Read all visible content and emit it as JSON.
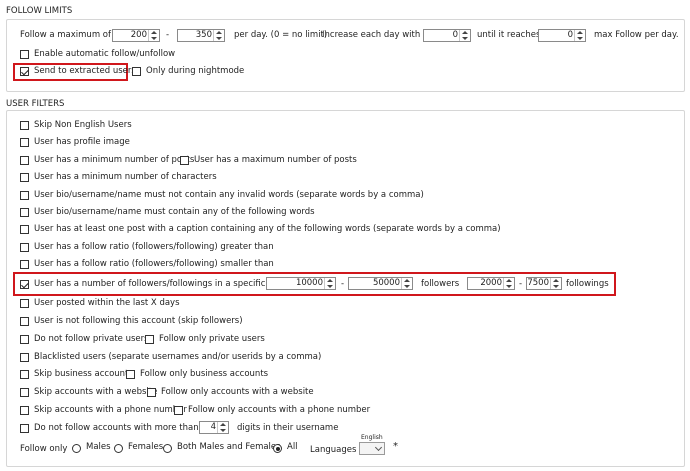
{
  "follow_limits": {
    "section_title": "FOLLOW LIMITS",
    "prefix": "Follow a maximum of",
    "min_value": "200",
    "dash": "-",
    "max_value": "350",
    "per_day": "per day. (0 = no limit)",
    "increase_label": "Increase each day with",
    "increase_value": "0",
    "until_label": "until it reaches",
    "until_value": "0",
    "max_follow_label": "max Follow per day.",
    "auto_follow_label": "Enable automatic follow/unfollow",
    "send_extracted_label": "Send to extracted users",
    "nightmode_label": "Only during nightmode"
  },
  "user_filters": {
    "section_title": "USER FILTERS",
    "skip_non_english": "Skip Non English Users",
    "has_profile_image": "User has profile image",
    "min_posts": "User has a minimum number of posts",
    "max_posts": "User has a maximum number of posts",
    "bio_min_chars": "User has a minimum number of characters",
    "bio_invalid_words": "User bio/username/name must not contain any invalid words (separate words by a comma)",
    "bio_contain_words": "User bio/username/name must contain any of the following words",
    "post_caption_words": "User has at least one post with a caption containing any of the following words (separate words by a comma)",
    "ratio_greater": "User has a follow ratio (followers/following) greater than",
    "ratio_smaller": "User has a follow ratio (followers/following) smaller than",
    "range_label": "User has a number of followers/followings in a specific range",
    "followers_min": "10000",
    "followers_max": "50000",
    "followers_label": "followers",
    "followings_min": "2000",
    "followings_max": "7500",
    "followings_label": "followings",
    "dash": "-",
    "posted_within": "User posted within the last X days",
    "not_following": "User is not following this account (skip followers)",
    "dont_follow_private": "Do not follow private users",
    "follow_only_private": "Follow only private users",
    "blacklisted": "Blacklisted users (separate usernames and/or userids by a comma)",
    "skip_business": "Skip business accounts",
    "follow_only_business": "Follow only business accounts",
    "skip_website": "Skip accounts with a website",
    "follow_only_website": "Follow only accounts with a website",
    "skip_phone": "Skip accounts with a phone number",
    "follow_only_phone": "Follow only accounts with a phone number",
    "digits_prefix": "Do not follow accounts with more than",
    "digits_value": "4",
    "digits_suffix": "digits in their username",
    "follow_only_label": "Follow only",
    "males": "Males",
    "females": "Females",
    "both": "Both Males and Females",
    "all": "All",
    "languages_label": "Languages",
    "language_selected": "English",
    "asterisk": "*"
  },
  "colors": {
    "highlight": "#d0171c",
    "group_border": "#d6d6d6"
  }
}
